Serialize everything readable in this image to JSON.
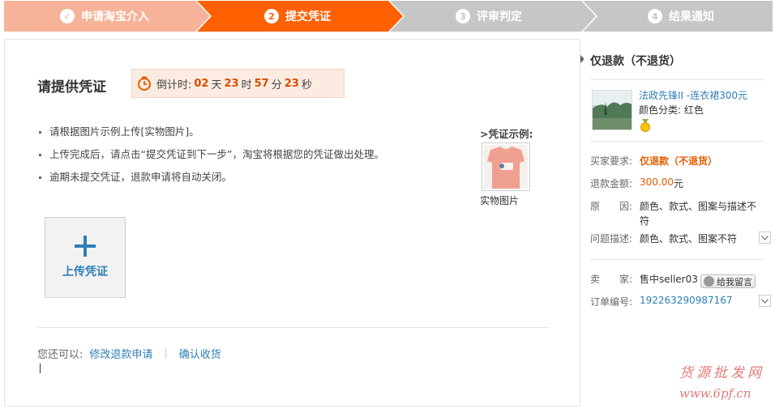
{
  "steps": [
    {
      "label": "申请淘宝介入",
      "icon": "✓",
      "state": "done"
    },
    {
      "label": "提交凭证",
      "icon": "2",
      "state": "active"
    },
    {
      "label": "评审判定",
      "icon": "3",
      "state": "todo"
    },
    {
      "label": "结果通知",
      "icon": "4",
      "state": "todo"
    }
  ],
  "colors": {
    "step_done": "#f6b39a",
    "step_active": "#ff6000",
    "step_todo": "#c6c6c6",
    "link": "#2e7eb8",
    "accent": "#e65c00"
  },
  "main": {
    "title": "请提供凭证",
    "countdown": {
      "label": "倒计时:",
      "days": "02",
      "days_unit": "天",
      "hours": "23",
      "hours_unit": "时",
      "minutes": "57",
      "minutes_unit": "分",
      "seconds": "23",
      "seconds_unit": "秒"
    },
    "tips": [
      "请根据图片示例上传[实物图片]。",
      "上传完成后，请点击“提交凭证到下一步”，淘宝将根据您的凭证做出处理。",
      "逾期未提交凭证，退款申请将自动关闭。"
    ],
    "example_title": ">凭证示例:",
    "example_caption": "实物图片",
    "upload_label": "上传凭证",
    "actions_prefix": "您还可以:",
    "action_modify": "修改退款申请",
    "action_confirm": "确认收货"
  },
  "side": {
    "title": "仅退款（不退货）",
    "product_name": "法政先锋II -连衣裙300元",
    "product_attr": "颜色分类: 红色",
    "rows": [
      {
        "key": "买家要求:",
        "value": "仅退款（不退货）"
      },
      {
        "key": "退款金额:",
        "value": "300.00",
        "suffix": "元"
      },
      {
        "key": "原　　因:",
        "value": "颜色、款式、图案与描述不符"
      },
      {
        "key": "问题描述:",
        "value": "颜色、款式、图案不符"
      },
      {
        "key": "卖　　家:",
        "value": "售中seller03"
      },
      {
        "key": "订单编号:",
        "value": "192263290987167"
      }
    ],
    "message_button": "给我留言"
  },
  "watermark": {
    "line1": "货源批发网",
    "line2": "www.6pf.cn"
  }
}
